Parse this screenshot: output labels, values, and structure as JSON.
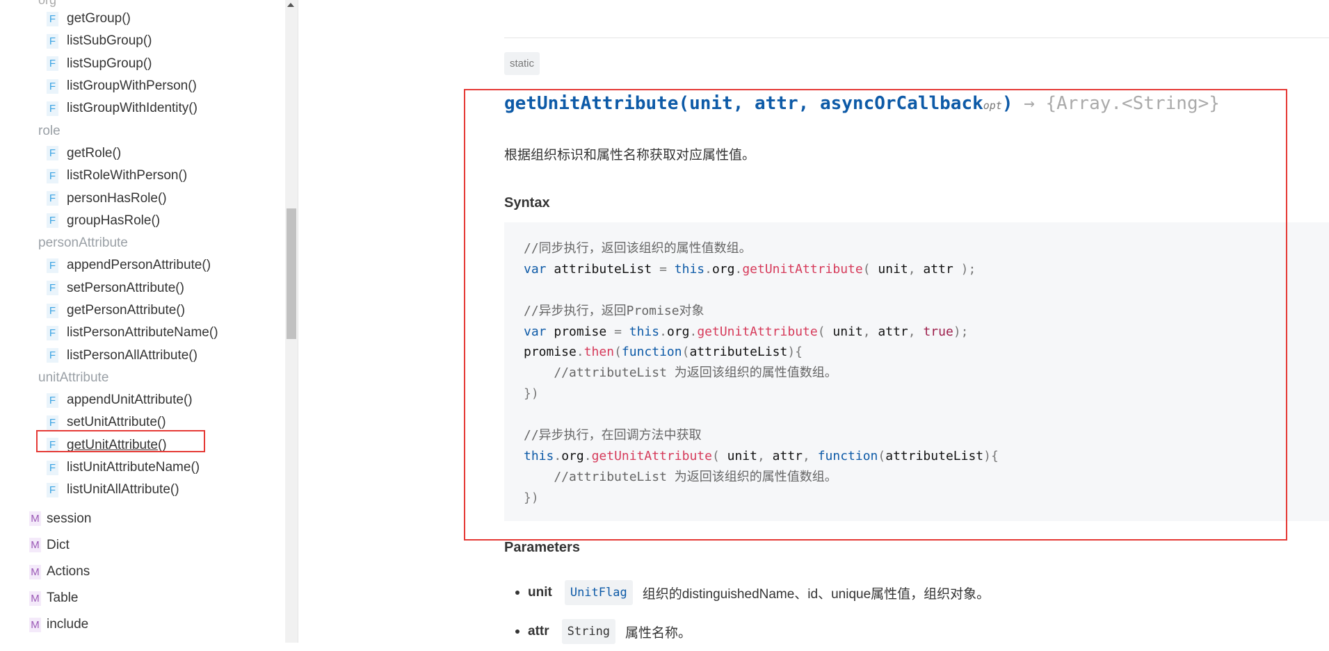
{
  "sidebar": {
    "cut_label": "org",
    "groups": [
      {
        "kind": "func",
        "label": "getGroup()"
      },
      {
        "kind": "func",
        "label": "listSubGroup()"
      },
      {
        "kind": "func",
        "label": "listSupGroup()"
      },
      {
        "kind": "func",
        "label": "listGroupWithPerson()"
      },
      {
        "kind": "func",
        "label": "listGroupWithIdentity()"
      },
      {
        "kind": "group",
        "label": "role"
      },
      {
        "kind": "func",
        "label": "getRole()"
      },
      {
        "kind": "func",
        "label": "listRoleWithPerson()"
      },
      {
        "kind": "func",
        "label": "personHasRole()"
      },
      {
        "kind": "func",
        "label": "groupHasRole()"
      },
      {
        "kind": "group",
        "label": "personAttribute"
      },
      {
        "kind": "func",
        "label": "appendPersonAttribute()"
      },
      {
        "kind": "func",
        "label": "setPersonAttribute()"
      },
      {
        "kind": "func",
        "label": "getPersonAttribute()"
      },
      {
        "kind": "func",
        "label": "listPersonAttributeName()"
      },
      {
        "kind": "func",
        "label": "listPersonAllAttribute()"
      },
      {
        "kind": "group",
        "label": "unitAttribute"
      },
      {
        "kind": "func",
        "label": "appendUnitAttribute()"
      },
      {
        "kind": "func",
        "label": "setUnitAttribute()"
      },
      {
        "kind": "func",
        "label": "getUnitAttribute",
        "suffix": "()",
        "active": true
      },
      {
        "kind": "func",
        "label": "listUnitAttributeName()"
      },
      {
        "kind": "func",
        "label": "listUnitAllAttribute()"
      }
    ],
    "modules": [
      "session",
      "Dict",
      "Actions",
      "Table",
      "include"
    ],
    "func_badge": "F",
    "module_badge": "M"
  },
  "main": {
    "static_tag": "static",
    "signature": {
      "name": "getUnitAttribute",
      "open": "(",
      "params": "unit, attr, asyncOrCallback",
      "opt": "opt",
      "close": ")",
      "returns": " → {Array.<String>}"
    },
    "description": "根据组织标识和属性名称获取对应属性值。",
    "syntax_heading": "Syntax",
    "params_heading": "Parameters",
    "params": [
      {
        "name": "unit",
        "type": "UnitFlag",
        "type_link": true,
        "desc": "组织的distinguishedName、id、unique属性值，组织对象。"
      },
      {
        "name": "attr",
        "type": "String",
        "type_link": false,
        "desc": "属性名称。"
      }
    ]
  },
  "colors": {
    "highlight": "#e53935",
    "keyword": "#0d5aa7",
    "function": "#d63a5a"
  }
}
